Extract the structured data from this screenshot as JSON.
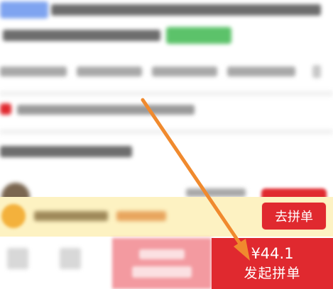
{
  "group_buy": {
    "go_group_label": "去拼单"
  },
  "bottom_bar": {
    "start_group_price": "¥44.1",
    "start_group_label": "发起拼单"
  },
  "colors": {
    "accent_red": "#e0292f",
    "arrow_orange": "#f08a2e",
    "strip_yellow": "#fdf2c2"
  },
  "icons": {
    "annotation": "arrow-icon"
  }
}
